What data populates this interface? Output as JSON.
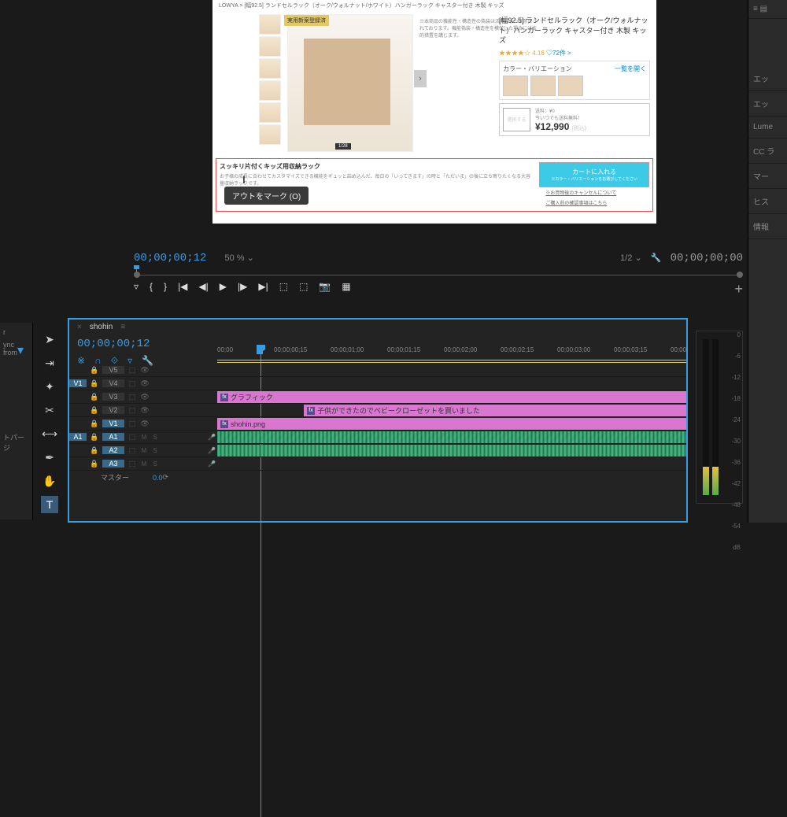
{
  "right_panel": {
    "tabs": [
      "エッ",
      "エッ",
      "Lume",
      "CC ラ",
      "マー",
      "ヒス",
      "情報"
    ]
  },
  "preview": {
    "breadcrumb": "LOWYA > [幅92.5] ランドセルラック（オーク/ウォルナット/ホワイト）ハンガーラック キャスター付き 木製 キッズ",
    "badge": "実用新案登録済",
    "notice_text": "※本商品の機能性・構造性の偽装は活用によって禁止されております。機能偽装・構造性を模倣した場合には法的措置を講じます。",
    "title": "[幅92.5] ランドセルラック（オーク/ウォルナット）ハンガーラック キャスター付き 木製 キッズ",
    "rating_value": "4.16",
    "rating_count": "♡72件 >",
    "variation_label": "カラー・バリエーション",
    "variation_link": "一覧を開く",
    "select_btn": "選択する",
    "shipping_label": "送料：¥0",
    "shipping_note": "今いつでも送料無料！",
    "price": "¥12,990",
    "price_tax": "(税込)",
    "image_counter": "1/28",
    "desc_title": "スッキリ片付くキッズ用収納ラック",
    "desc_sub": "お子様の成長に合わせてカスタマイズできる機能をギュッと詰め込んだ、毎日の「いってきます」の時と「ただいま」の後に立ち寄りたくなる大容量収納ラックです。",
    "cart_label": "カートに入れる",
    "cart_sub": "※カラー・バリエーションをお選びしてください",
    "note1": "※お買物後のキャンセルについて",
    "note2": "ご購入前の確認事項はこちら"
  },
  "tooltip": "アウトをマーク (O)",
  "transport": {
    "timecode_left": "00;00;00;12",
    "zoom": "50 %",
    "resolution": "1/2",
    "timecode_right": "00;00;00;00"
  },
  "left_panel": {
    "items": [
      "r",
      "ync from",
      "",
      "トパージ"
    ]
  },
  "timeline": {
    "tab_name": "shohin",
    "timecode": "00;00;00;12",
    "ruler_ticks": [
      "00;00",
      "00;00;00;15",
      "00;00;01;00",
      "00;00;01;15",
      "00;00;02;00",
      "00;00;02;15",
      "00;00;03;00",
      "00;00;03;15",
      "00;00;"
    ],
    "tracks": {
      "v_labels": [
        "V5",
        "V4",
        "V3",
        "V2",
        "V1"
      ],
      "a_labels": [
        "A1",
        "A2",
        "A3"
      ],
      "source_v": "V1",
      "source_a": "A1",
      "master_label": "マスター",
      "master_value": "0.0"
    },
    "clips": {
      "v3_label": "グラフィック",
      "v2_label": "子供ができたのでベビークローゼットを買いました",
      "v1_label": "shohin.png"
    }
  },
  "meters": {
    "scale": [
      "0",
      "-6",
      "-12",
      "-18",
      "-24",
      "-30",
      "-36",
      "-42",
      "-48",
      "-54",
      "dB"
    ]
  }
}
